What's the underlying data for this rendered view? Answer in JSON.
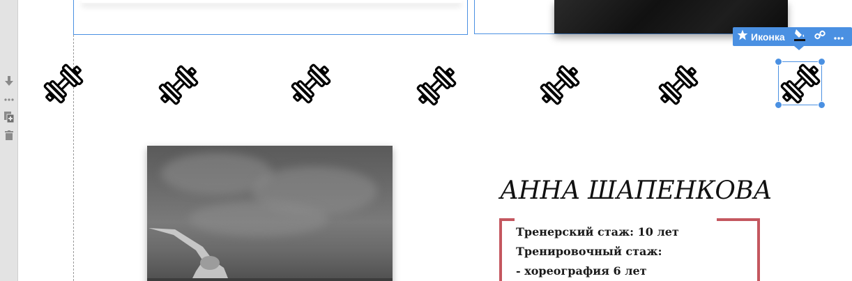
{
  "toolbar": {
    "label": "Иконка",
    "accent": "#4a90e2",
    "buttons": [
      "star-icon",
      "fill-color-icon",
      "link-icon",
      "more-icon"
    ]
  },
  "rail_tools": [
    "move-down-icon",
    "more-dots-icon",
    "duplicate-icon",
    "delete-icon"
  ],
  "icons": {
    "name": "dumbbell-icon",
    "count": 7
  },
  "coach": {
    "name": "АННА ШАПЕНКОВА",
    "frame_color": "#c4575f",
    "lines": [
      "Тренерский стаж: 10 лет",
      "Тренировочный стаж:",
      "- хореография 6 лет"
    ]
  }
}
